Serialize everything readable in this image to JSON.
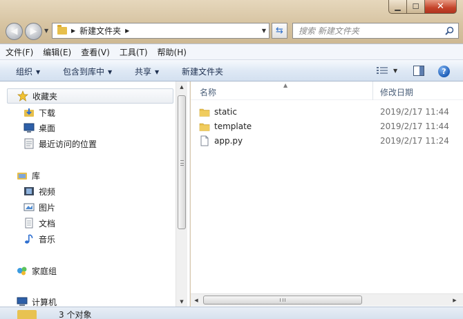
{
  "address": {
    "breadcrumb": [
      "新建文件夹"
    ]
  },
  "search": {
    "placeholder": "搜索 新建文件夹"
  },
  "menu": [
    "文件(F)",
    "编辑(E)",
    "查看(V)",
    "工具(T)",
    "帮助(H)"
  ],
  "toolbar": {
    "organize": "组织",
    "include_in_library": "包含到库中",
    "share": "共享",
    "new_folder": "新建文件夹"
  },
  "nav": {
    "favorites": {
      "label": "收藏夹",
      "items": [
        "下载",
        "桌面",
        "最近访问的位置"
      ]
    },
    "libraries": {
      "label": "库",
      "items": [
        "视频",
        "图片",
        "文档",
        "音乐"
      ]
    },
    "homegroup": "家庭组",
    "computer": "计算机"
  },
  "columns": {
    "name": "名称",
    "date_modified": "修改日期"
  },
  "files": [
    {
      "name": "static",
      "date": "2019/2/17 11:44",
      "type": "folder"
    },
    {
      "name": "template",
      "date": "2019/2/17 11:44",
      "type": "folder"
    },
    {
      "name": "app.py",
      "date": "2019/2/17 11:24",
      "type": "file"
    }
  ],
  "status": {
    "count": "3 个对象"
  },
  "colors": {
    "title_bar": "#d7c4a2",
    "toolbar": "#dfe9f5",
    "folder": "#e7bf4b",
    "header_text": "#4c607a"
  }
}
